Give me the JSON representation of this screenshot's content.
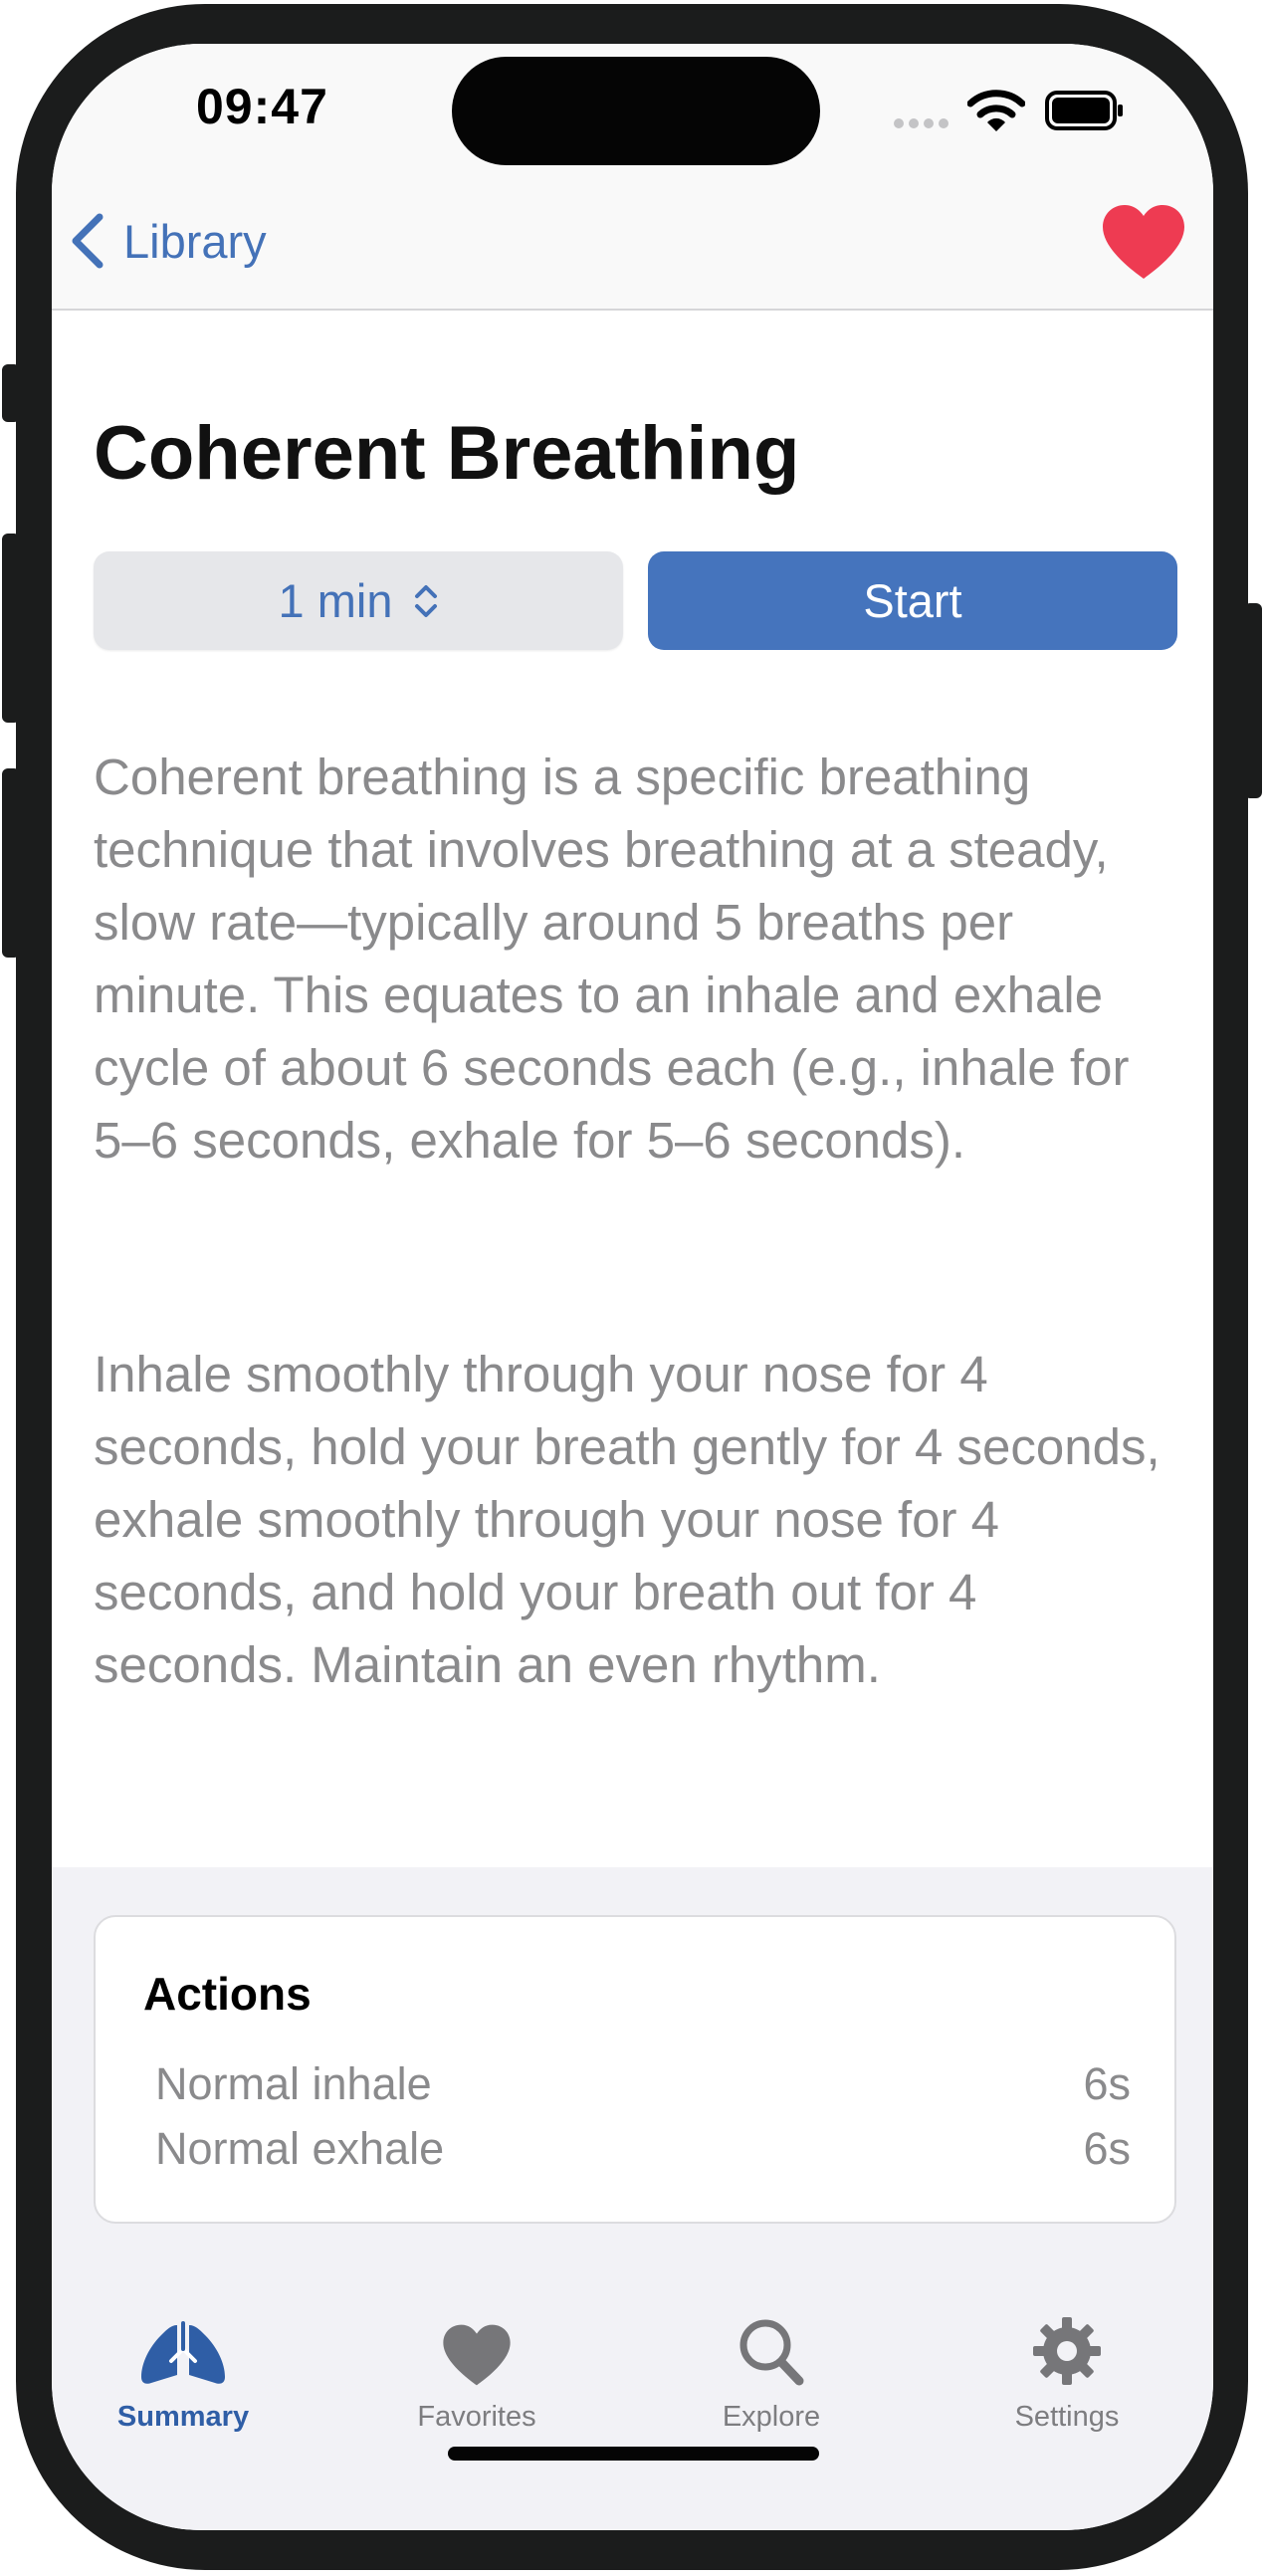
{
  "status_bar": {
    "time": "09:47"
  },
  "nav": {
    "back_label": "Library"
  },
  "page": {
    "title": "Coherent Breathing"
  },
  "controls": {
    "duration_label": "1 min",
    "start_label": "Start"
  },
  "description": {
    "paragraph_1": "Coherent breathing is a specific breathing technique that involves breathing at a steady, slow rate—typically around 5 breaths per minute. This equates to an inhale and exhale cycle of about 6 seconds each (e.g., inhale for 5–6 seconds, exhale for 5–6 seconds).",
    "paragraph_2": "Inhale smoothly through your nose for 4 seconds, hold your breath gently for 4 seconds, exhale smoothly through your nose for 4 seconds, and hold your breath out for 4 seconds. Maintain an even rhythm."
  },
  "actions": {
    "title": "Actions",
    "items": [
      {
        "label": "Normal inhale",
        "value": "6s"
      },
      {
        "label": "Normal exhale",
        "value": "6s"
      }
    ]
  },
  "tabs": [
    {
      "label": "Summary",
      "icon": "lungs-icon",
      "active": true
    },
    {
      "label": "Favorites",
      "icon": "heart-icon",
      "active": false
    },
    {
      "label": "Explore",
      "icon": "search-icon",
      "active": false
    },
    {
      "label": "Settings",
      "icon": "gear-icon",
      "active": false
    }
  ],
  "colors": {
    "accent": "#4574bd",
    "link": "#4472b8",
    "favorite": "#ee3b52",
    "secondary_text": "#8a8a8c",
    "tab_inactive": "#7d7d80"
  }
}
